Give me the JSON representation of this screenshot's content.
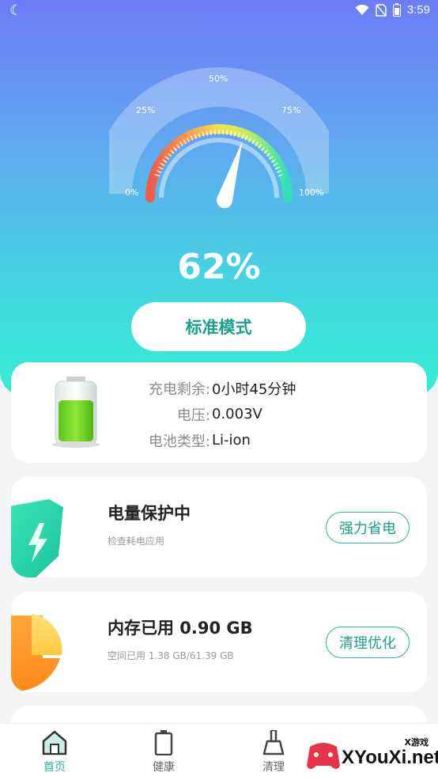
{
  "status_bar": {
    "time": "3:59",
    "icons": [
      "moon-icon",
      "wifi-icon",
      "no-sim-icon",
      "battery-icon"
    ]
  },
  "gauge": {
    "percent_text": "62%",
    "percent_value": 62,
    "tick_labels": [
      "0%",
      "25%",
      "50%",
      "75%",
      "100%"
    ]
  },
  "mode_button": {
    "label": "标准模式"
  },
  "battery_card": {
    "rows": [
      {
        "label": "充电剩余:",
        "value": "0小时45分钟"
      },
      {
        "label": "电压:",
        "value": "0.003V"
      },
      {
        "label": "电池类型:",
        "value": "Li-ion"
      }
    ]
  },
  "feature_cards": [
    {
      "title": "电量保护中",
      "subtitle": "检查耗电应用",
      "button": "强力省电",
      "icon": "shield-lightning-icon"
    },
    {
      "title": "内存已用 0.90 GB",
      "subtitle": "空间已用 1.38 GB/61.39 GB",
      "button": "清理优化",
      "icon": "storage-pie-icon"
    }
  ],
  "tab_bar": {
    "tabs": [
      {
        "label": "首页",
        "icon": "home-icon",
        "active": true
      },
      {
        "label": "健康",
        "icon": "battery-tab-icon",
        "active": false
      },
      {
        "label": "清理",
        "icon": "broom-icon",
        "active": false
      }
    ]
  },
  "watermark": {
    "brand": "XYouXi.net",
    "tag": "X游戏"
  },
  "colors": {
    "accent": "#2bb39b",
    "accent_text": "#1ca08a",
    "gradient_top": "#6c7cf6",
    "gradient_bottom": "#33eecf"
  }
}
